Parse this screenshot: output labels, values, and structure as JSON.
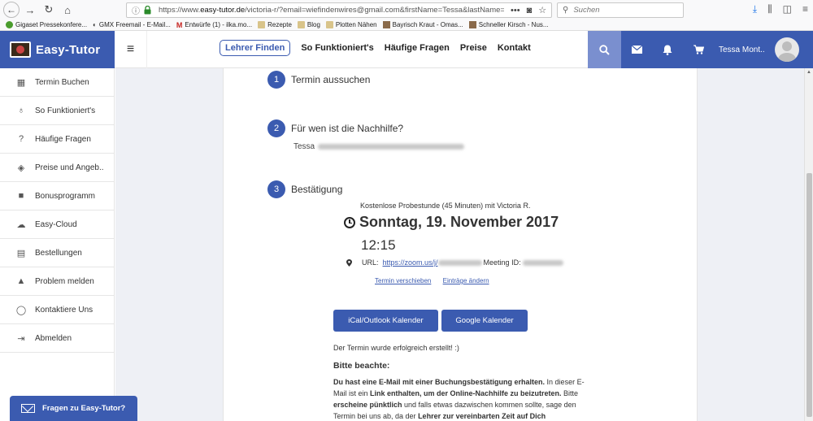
{
  "browser": {
    "url_prefix": "https://www.",
    "url_host": "easy-tutor.de",
    "url_rest": "/victoria-r/?email=wiefindenwires@gmail.com&firstName=Tessa&lastName=Mont",
    "search_placeholder": "Suchen",
    "bookmarks": [
      {
        "label": "Gigaset Pressekonfere...",
        "icon": "green"
      },
      {
        "label": "GMX Freemail - E-Mail...",
        "icon": "gmx"
      },
      {
        "label": "Entwürfe (1) - ilka.mo...",
        "icon": "gmail"
      },
      {
        "label": "Rezepte",
        "icon": "folder"
      },
      {
        "label": "Blog",
        "icon": "folder"
      },
      {
        "label": "Plotten Nähen",
        "icon": "folder"
      },
      {
        "label": "Bayrisch Kraut - Omas...",
        "icon": "img"
      },
      {
        "label": "Schneller Kirsch - Nus...",
        "icon": "img"
      }
    ]
  },
  "header": {
    "logo": "Easy-Tutor",
    "nav": [
      "Lehrer Finden",
      "So Funktioniert's",
      "Häufige Fragen",
      "Preise",
      "Kontakt"
    ],
    "user_name": "Tessa Mont.."
  },
  "sidebar": {
    "items": [
      {
        "label": "Termin Buchen",
        "icon": "calendar-icon",
        "glyph": "▦"
      },
      {
        "label": "So Funktioniert's",
        "icon": "lightbulb-icon",
        "glyph": "♁"
      },
      {
        "label": "Häufige Fragen",
        "icon": "question-icon",
        "glyph": "?"
      },
      {
        "label": "Preise und Angeb..",
        "icon": "tag-icon",
        "glyph": "◈"
      },
      {
        "label": "Bonusprogramm",
        "icon": "gift-icon",
        "glyph": "■"
      },
      {
        "label": "Easy-Cloud",
        "icon": "cloud-icon",
        "glyph": "☁"
      },
      {
        "label": "Bestellungen",
        "icon": "id-card-icon",
        "glyph": "▤"
      },
      {
        "label": "Problem melden",
        "icon": "warning-icon",
        "glyph": "▲"
      },
      {
        "label": "Kontaktiere Uns",
        "icon": "whatsapp-icon",
        "glyph": "◯"
      },
      {
        "label": "Abmelden",
        "icon": "logout-icon",
        "glyph": "⇥"
      }
    ]
  },
  "steps": [
    {
      "num": "1",
      "title": "Termin aussuchen"
    },
    {
      "num": "2",
      "title": "Für wen ist die Nachhilfe?"
    },
    {
      "num": "3",
      "title": "Bestätigung"
    }
  ],
  "person_first": "Tessa",
  "confirmation": {
    "subtitle": "Kostenlose Probestunde (45 Minuten) mit Victoria R.",
    "date": "Sonntag, 19. November 2017",
    "time": "12:15",
    "url_label": "URL:",
    "url_link": "https://zoom.us/j/",
    "meeting_label": "Meeting ID:",
    "action_reschedule": "Termin verschieben",
    "action_edit": "Einträge ändern"
  },
  "buttons": {
    "ical": "iCal/Outlook Kalender",
    "google": "Google Kalender"
  },
  "after": {
    "success": "Der Termin wurde erfolgreich erstellt! :)",
    "note_title": "Bitte beachte:",
    "p1_bold": "Du hast eine E-Mail mit einer Buchungsbestätigung erhalten.",
    "p1_a": " In dieser E-Mail ist ein ",
    "p1_bold2": "Link enthalten, um der Online-Nachhilfe zu beizutreten.",
    "p2_a": " Bitte ",
    "p2_bold": "erscheine pünktlich",
    "p2_b": " und falls etwas dazwischen kommen sollte, sage den Termin bei uns ab, da der ",
    "p2_bold2": "Lehrer zur vereinbarten Zeit auf Dich"
  },
  "help_button": "Fragen zu Easy-Tutor?",
  "colors": {
    "brand": "#3b5bb0",
    "background": "#eef0f5"
  }
}
